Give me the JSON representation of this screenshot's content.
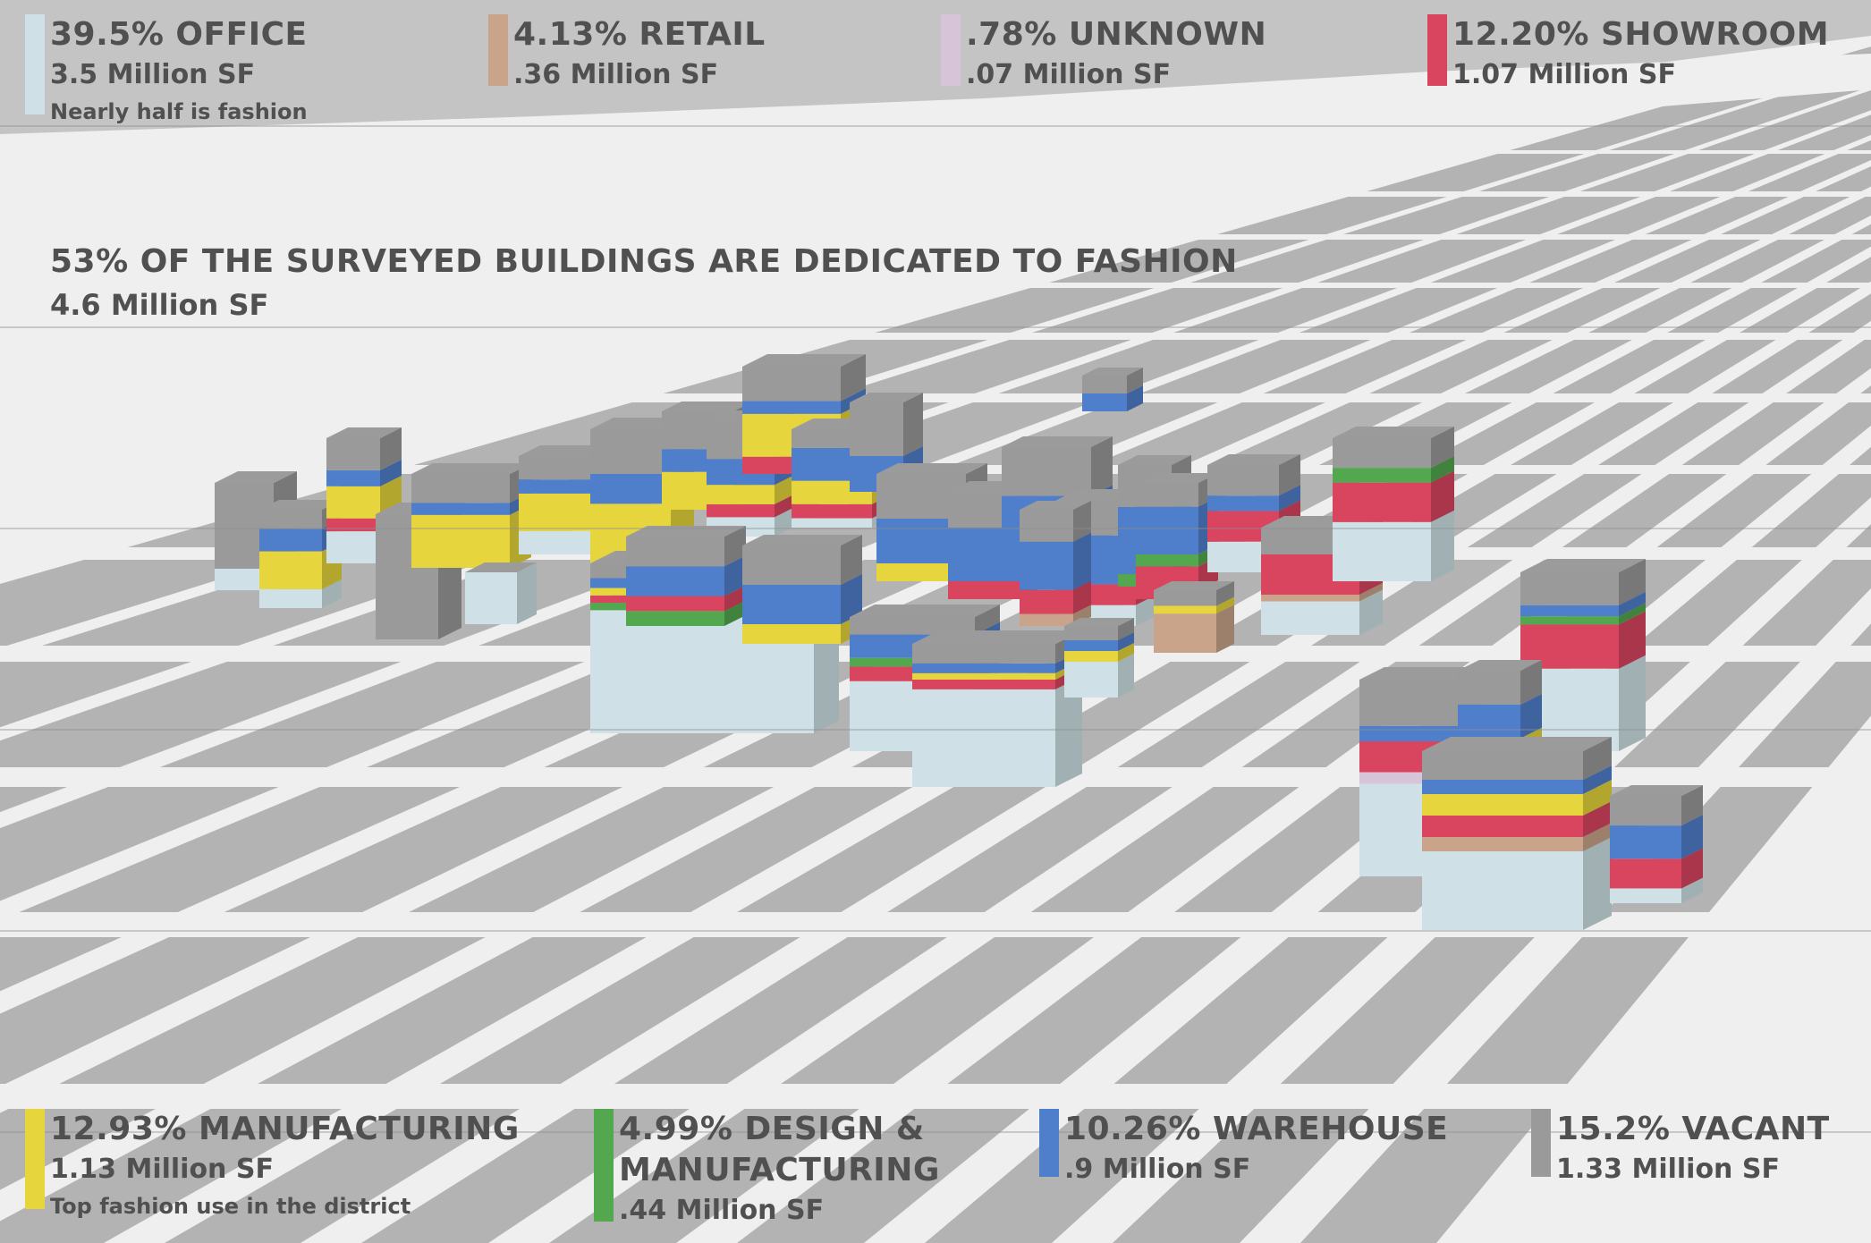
{
  "headline": {
    "title": "53% OF THE SURVEYED BUILDINGS ARE DEDICATED TO FASHION",
    "sub": "4.6 Million SF"
  },
  "legend": {
    "office": {
      "pct_label": "39.5% OFFICE",
      "area": "3.5 Million SF",
      "note": "Nearly half is fashion",
      "color": "#cfe1e6"
    },
    "retail": {
      "pct_label": "4.13% RETAIL",
      "area": ".36 Million SF",
      "color": "#c9a48a"
    },
    "unknown": {
      "pct_label": ".78% UNKNOWN",
      "area": ".07 Million SF",
      "color": "#d8c4d9"
    },
    "showroom": {
      "pct_label": "12.20% SHOWROOM",
      "area": "1.07 Million SF",
      "color": "#d9455f"
    },
    "manufacturing": {
      "pct_label": "12.93% MANUFACTURING",
      "area": "1.13 Million SF",
      "note": "Top fashion use in the district",
      "color": "#e6d53c"
    },
    "design": {
      "pct_label_1": "4.99% DESIGN &",
      "pct_label_2": "MANUFACTURING",
      "area": ".44 Million SF",
      "color": "#53a84f"
    },
    "warehouse": {
      "pct_label": "10.26% WAREHOUSE",
      "area": ".9 Million SF",
      "color": "#4f7fca"
    },
    "vacant": {
      "pct_label": "15.2% VACANT",
      "area": "1.33 Million SF",
      "color": "#9a9a9a"
    }
  },
  "map": {
    "street_color": "#efefef",
    "block_color": "#b3b3b3",
    "roof_color": "#9b9b9b",
    "icon": "3d-building-massing-map"
  }
}
